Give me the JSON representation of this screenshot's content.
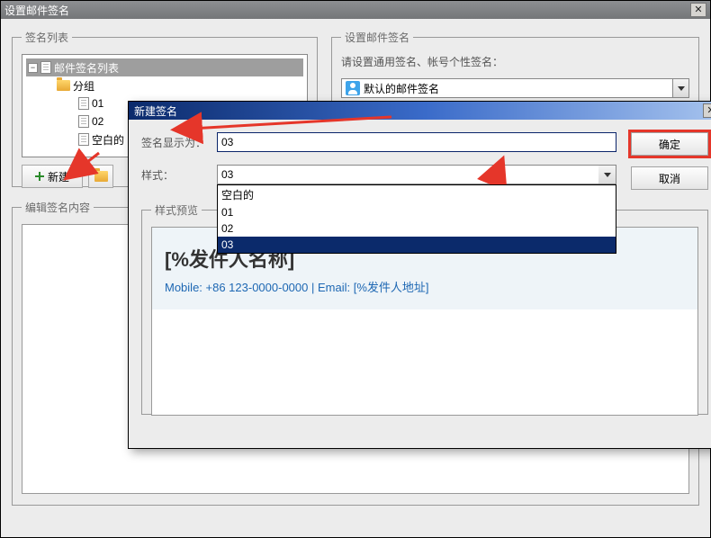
{
  "outer": {
    "title": "设置邮件签名"
  },
  "siglist": {
    "legend": "签名列表",
    "root": "邮件签名列表",
    "group": "分组",
    "items": [
      "01",
      "02",
      "空白的"
    ],
    "btn_new": "新建"
  },
  "setsig": {
    "legend": "设置邮件签名",
    "label": "请设置通用签名、帐号个性签名：",
    "default_sig": "默认的邮件签名"
  },
  "editcontent": {
    "legend": "编辑签名内容"
  },
  "modal": {
    "title": "新建签名",
    "name_label": "签名显示为：",
    "name_value": "03",
    "style_label": "样式：",
    "style_value": "03",
    "style_options": [
      "空白的",
      "01",
      "02",
      "03"
    ],
    "ok": "确定",
    "cancel": "取消",
    "preview_legend": "样式预览",
    "preview_sender": "[%发件人名称]",
    "preview_contact": "Mobile: +86 123-0000-0000  |  Email: [%发件人地址]"
  }
}
